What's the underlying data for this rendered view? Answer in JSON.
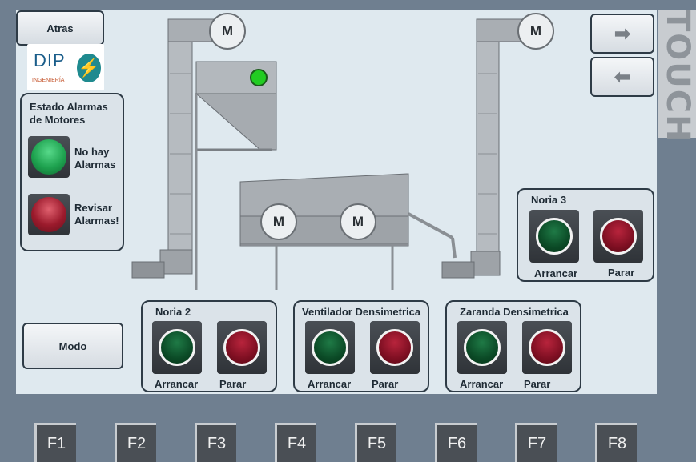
{
  "nav": {
    "back_label": "Atras",
    "mode_label": "Modo"
  },
  "logo": {
    "name": "DIP",
    "subtitle": "INGENIERÍA"
  },
  "touch_label": "TOUCH",
  "alarm_panel": {
    "title_line1": "Estado Alarmas",
    "title_line2": "de Motores",
    "ok_line1": "No hay",
    "ok_line2": "Alarmas",
    "check_line1": "Revisar",
    "check_line2": "Alarmas!"
  },
  "motor_label": "M",
  "controls": [
    {
      "title": "Noria 3",
      "start_label": "Arrancar",
      "stop_label": "Parar"
    },
    {
      "title": "Noria 2",
      "start_label": "Arrancar",
      "stop_label": "Parar"
    },
    {
      "title": "Ventilador Densimetrica",
      "start_label": "Arrancar",
      "stop_label": "Parar"
    },
    {
      "title": "Zaranda Densimetrica",
      "start_label": "Arrancar",
      "stop_label": "Parar"
    }
  ],
  "function_keys": [
    "F1",
    "F2",
    "F3",
    "F4",
    "F5",
    "F6",
    "F7",
    "F8"
  ],
  "colors": {
    "running_indicator": "#22cc22",
    "start_led": "#0b4a26",
    "stop_led": "#7e0f22"
  }
}
